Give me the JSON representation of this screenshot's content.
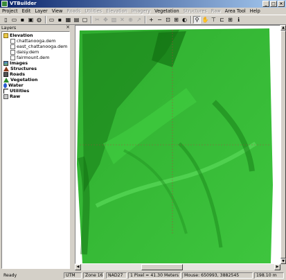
{
  "app": {
    "title": "VTBuilder"
  },
  "window_buttons": {
    "minimize": "_",
    "maximize": "□",
    "close": "×"
  },
  "menu": [
    {
      "label": "Project",
      "enabled": true
    },
    {
      "label": "Edit",
      "enabled": true
    },
    {
      "label": "Layer",
      "enabled": true
    },
    {
      "label": "View",
      "enabled": true
    },
    {
      "label": "Roads",
      "enabled": false
    },
    {
      "label": "Utilities",
      "enabled": false
    },
    {
      "label": "Elevation",
      "enabled": false
    },
    {
      "label": "Imagery",
      "enabled": false
    },
    {
      "label": "Vegetation",
      "enabled": true
    },
    {
      "label": "Structures",
      "enabled": false
    },
    {
      "label": "Raw",
      "enabled": false
    },
    {
      "label": "Area Tool",
      "enabled": true
    },
    {
      "label": "Help",
      "enabled": true
    }
  ],
  "toolbar": [
    {
      "name": "new-project",
      "glyph": "▯"
    },
    {
      "name": "open-project",
      "glyph": "▭"
    },
    {
      "name": "save-project",
      "glyph": "▪"
    },
    {
      "name": "properties",
      "glyph": "▣"
    },
    {
      "name": "globe",
      "glyph": "◍"
    },
    {
      "sep": true
    },
    {
      "name": "layer-open",
      "glyph": "▭"
    },
    {
      "name": "layer-save",
      "glyph": "▪"
    },
    {
      "name": "layer-import",
      "glyph": "▦"
    },
    {
      "name": "layer-show",
      "glyph": "▤"
    },
    {
      "name": "layer-up",
      "glyph": "▢"
    },
    {
      "sep": true
    },
    {
      "name": "cut",
      "glyph": "✂",
      "disabled": true
    },
    {
      "name": "select",
      "glyph": "✥",
      "disabled": true
    },
    {
      "name": "box-select",
      "glyph": "▧",
      "disabled": true
    },
    {
      "name": "cross",
      "glyph": "✕",
      "disabled": true
    },
    {
      "name": "distance",
      "glyph": "⊕",
      "disabled": true
    },
    {
      "name": "arrow",
      "glyph": "↗",
      "disabled": true
    },
    {
      "sep": true
    },
    {
      "name": "zoom-in",
      "glyph": "+"
    },
    {
      "name": "zoom-out",
      "glyph": "−"
    },
    {
      "name": "zoom-all",
      "glyph": "⊡"
    },
    {
      "name": "zoom-layer",
      "glyph": "⊞"
    },
    {
      "name": "shade",
      "glyph": "◐"
    },
    {
      "sep": true
    },
    {
      "name": "magnify",
      "glyph": "⚲",
      "pressed": true
    },
    {
      "name": "pan",
      "glyph": "✋"
    },
    {
      "name": "measure",
      "glyph": "⊤"
    },
    {
      "name": "profile",
      "glyph": "⊏"
    },
    {
      "name": "grid",
      "glyph": "⊞"
    },
    {
      "name": "info",
      "glyph": "ℹ"
    }
  ],
  "layers": {
    "header": "Layers",
    "close": "×",
    "tree": [
      {
        "label": "Elevation",
        "level": 0,
        "bold": true,
        "icon": "folder-icon",
        "expand": "−"
      },
      {
        "label": "chattanooga.dem",
        "level": 1,
        "icon": "file-icon"
      },
      {
        "label": "east_chattanooga.dem",
        "level": 1,
        "icon": "file-icon"
      },
      {
        "label": "daisy.dem",
        "level": 1,
        "icon": "file-icon"
      },
      {
        "label": "fairmount.dem",
        "level": 1,
        "icon": "file-icon"
      },
      {
        "label": "Images",
        "level": 0,
        "bold": true,
        "icon": "images-icon"
      },
      {
        "label": "Structures",
        "level": 0,
        "bold": true,
        "icon": "structures-icon"
      },
      {
        "label": "Roads",
        "level": 0,
        "bold": true,
        "icon": "roads-icon"
      },
      {
        "label": "Vegetation",
        "level": 0,
        "bold": true,
        "icon": "vegetation-icon"
      },
      {
        "label": "Water",
        "level": 0,
        "bold": true,
        "icon": "water-icon"
      },
      {
        "label": "Utilities",
        "level": 0,
        "bold": true,
        "icon": "utilities-icon"
      },
      {
        "label": "Raw",
        "level": 0,
        "bold": true,
        "icon": "raw-icon"
      }
    ]
  },
  "colors": {
    "terrain_light": "#3ec53e",
    "terrain_mid": "#2fae2f",
    "terrain_dark": "#167a16",
    "crosshair": "#b34040"
  },
  "status": {
    "ready": "Ready",
    "projection": "UTM",
    "zone": "Zone 16",
    "datum": "NAD27",
    "scale": "1 Pixel = 41.30 Meters",
    "mouse": "Mouse: 650993, 3882545",
    "elevation": "198.10 m"
  }
}
